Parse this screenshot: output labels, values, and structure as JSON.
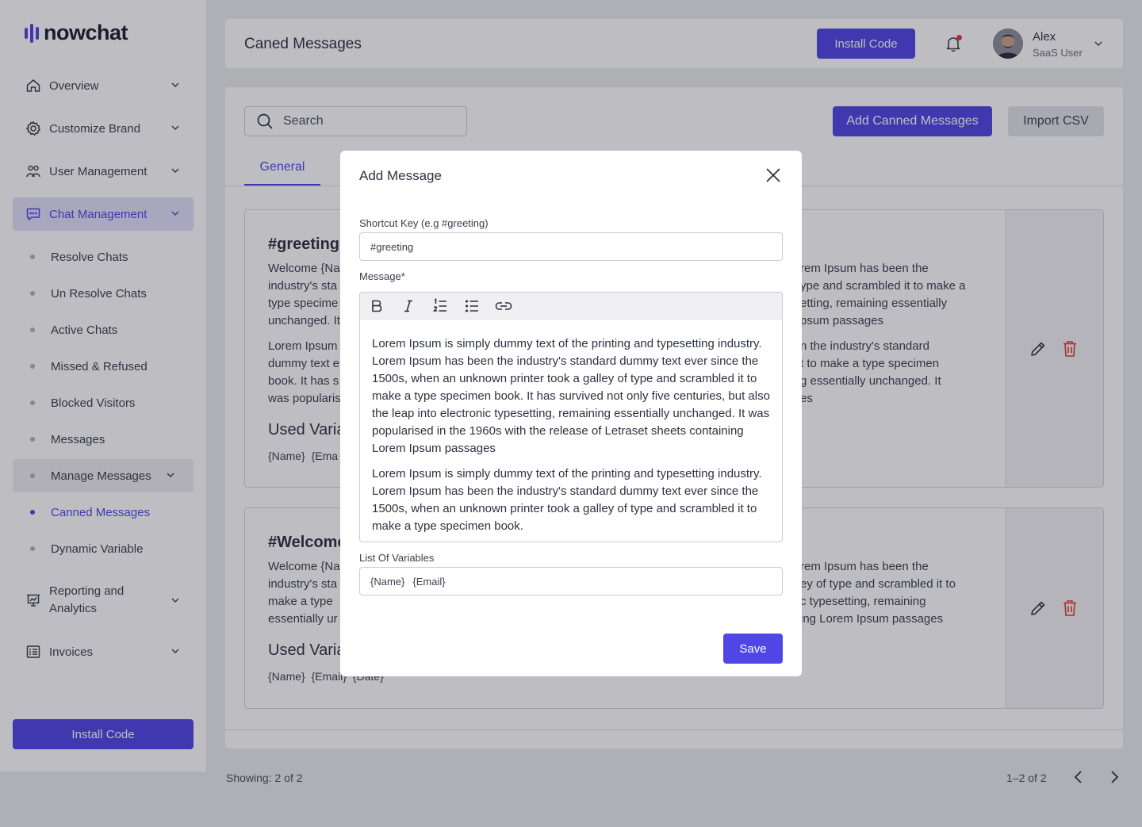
{
  "brand": {
    "name": "nowchat",
    "accent": "#4f46e5"
  },
  "sidebar": {
    "nav": [
      {
        "label": "Overview",
        "icon": "home-icon"
      },
      {
        "label": "Customize Brand",
        "icon": "gear-icon"
      },
      {
        "label": "User Management",
        "icon": "users-icon"
      },
      {
        "label": "Chat Management",
        "icon": "chat-icon"
      },
      {
        "label": "Reporting and Analytics",
        "icon": "presentation-chart-icon"
      },
      {
        "label": "Invoices",
        "icon": "invoice-list-icon"
      }
    ],
    "chat_sub": [
      "Resolve Chats",
      "Un Resolve Chats",
      "Active Chats",
      "Missed & Refused",
      "Blocked Visitors",
      "Messages",
      "Manage Messages",
      "Canned Messages",
      "Dynamic Variable"
    ],
    "install_label": "Install Code"
  },
  "header": {
    "title": "Caned Messages",
    "install_label": "Install Code",
    "user": {
      "name": "Alex",
      "role": "SaaS User"
    }
  },
  "toolbar": {
    "search_placeholder": "Search",
    "add_label": "Add Canned Messages",
    "import_label": "Import CSV"
  },
  "tabs": [
    {
      "label": "General"
    }
  ],
  "messages": [
    {
      "key": "#greeting",
      "left_lines": [
        "Welcome {Na",
        "industry's sta",
        "type specime",
        "unchanged. It"
      ],
      "left_lines_2": [
        "Lorem Ipsum",
        "dummy text e",
        "book. It has s",
        "was popularis"
      ],
      "right_lines": [
        "rem Ipsum has been the",
        "ype and scrambled it to make a",
        "etting, remaining essentially",
        "psum passages"
      ],
      "right_lines_2": [
        "n the industry's standard",
        "t to make a type specimen",
        "g essentially unchanged. It",
        "es"
      ],
      "used_label": "Used Varia",
      "vars": "{Name}  {Ema"
    },
    {
      "key": "#Welcome",
      "left_lines": [
        "Welcome {Na",
        "industry's sta",
        "make a type",
        "essentially ur"
      ],
      "right_lines": [
        "rem Ipsum has been the",
        "ey of type and scrambled it to",
        "c typesetting, remaining",
        "ing Lorem Ipsum passages"
      ],
      "used_label": "Used Varia",
      "vars": "{Name}  {Email}  {Date}"
    }
  ],
  "footer": {
    "showing": "Showing: 2 of 2",
    "range": "1–2 of 2"
  },
  "modal": {
    "title": "Add Message",
    "shortcut_label": "Shortcut Key (e.g #greeting)",
    "shortcut_value": "#greeting",
    "message_label": "Message*",
    "editor_tools": [
      "bold-icon",
      "italic-icon",
      "ordered-list-icon",
      "bullet-list-icon",
      "link-icon"
    ],
    "paragraphs": [
      "Lorem Ipsum is simply dummy text of the printing and typesetting industry. Lorem Ipsum has been the industry's standard dummy text ever since the 1500s, when an unknown printer took a galley of type and scrambled it to make a type specimen book. It has survived not only five centuries, but also the leap into electronic typesetting, remaining essentially unchanged. It was popularised in the 1960s with the release of Letraset sheets containing Lorem Ipsum passages",
      "Lorem Ipsum is simply dummy text of the printing and typesetting industry. Lorem Ipsum has been the industry's standard dummy text ever since the 1500s, when an unknown printer took a galley of type and scrambled it to make a type specimen book."
    ],
    "variables_label": "List Of Variables",
    "variables": [
      "{Name}",
      "{Email}"
    ],
    "save_label": "Save"
  }
}
